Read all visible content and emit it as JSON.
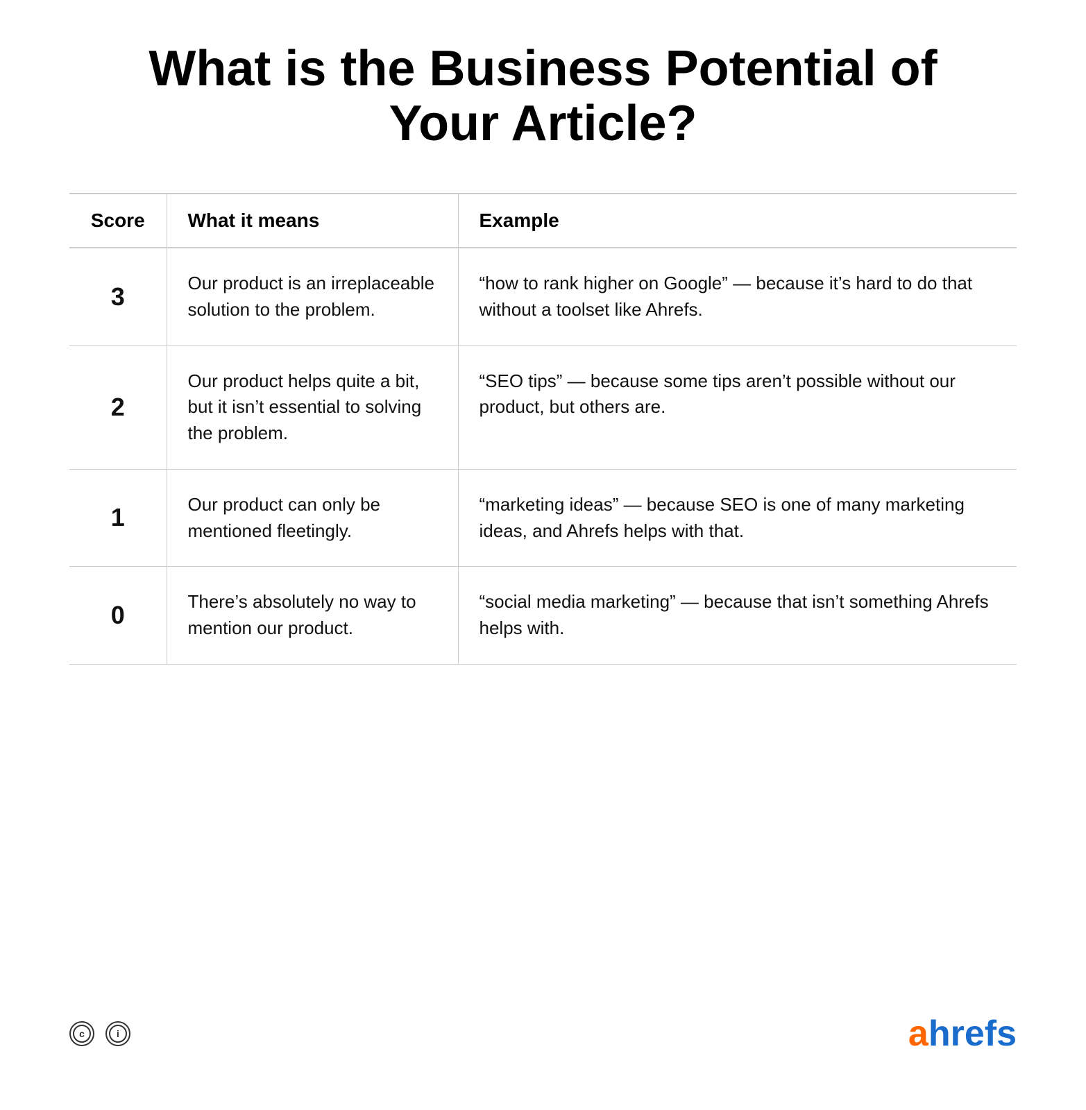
{
  "page": {
    "title": "What is the Business Potential of Your Article?",
    "background_color": "#ffffff"
  },
  "table": {
    "headers": {
      "score": "Score",
      "what_it_means": "What it means",
      "example": "Example"
    },
    "rows": [
      {
        "score": "3",
        "what_it_means": "Our product is an irreplaceable solution to the problem.",
        "example": "“how to rank higher on Google” — because it’s hard to do that without a toolset like Ahrefs."
      },
      {
        "score": "2",
        "what_it_means": "Our product helps quite a bit, but it isn’t essential to solving the problem.",
        "example": "“SEO tips” — because some tips aren’t possible without our product, but others are."
      },
      {
        "score": "1",
        "what_it_means": "Our product can only be mentioned fleetingly.",
        "example": "“marketing ideas” — because SEO is one of many marketing ideas, and Ahrefs helps with that."
      },
      {
        "score": "0",
        "what_it_means": "There’s absolutely no way to mention our product.",
        "example": "“social media marketing” — because that isn’t something Ahrefs helps with."
      }
    ]
  },
  "footer": {
    "license_icon_cc": "©",
    "license_icon_info": "i",
    "brand": {
      "prefix": "a",
      "suffix": "hrefs",
      "prefix_color": "#ff6600",
      "suffix_color": "#1a6ccc"
    }
  }
}
